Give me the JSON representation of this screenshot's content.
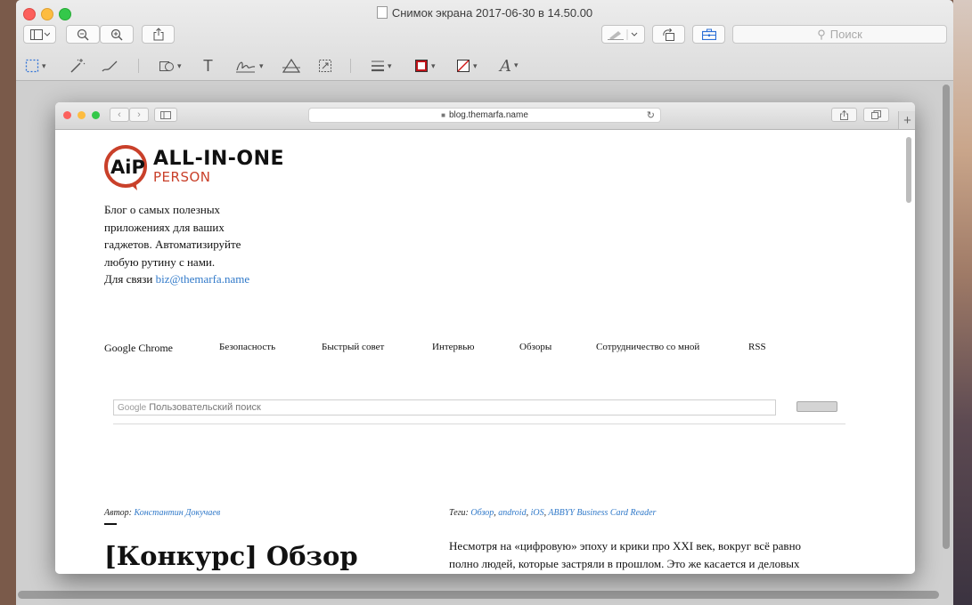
{
  "window": {
    "title": "Снимок экрана 2017-06-30 в 14.50.00",
    "search_placeholder": "Поиск"
  },
  "safari": {
    "url": "blog.themarfa.name"
  },
  "site": {
    "logo_mark": "AiP",
    "logo_line1": "ALL-IN-ONE",
    "logo_line2": "PERSON",
    "about_lines": [
      "Блог о самых полезных",
      "приложениях для ваших",
      "гаджетов. Автоматизируйте",
      "любую рутину с нами."
    ],
    "contact_prefix": "Для связи",
    "contact_email": "biz@themarfa.name",
    "menu": [
      "Google Chrome",
      "Безопасность",
      "Быстрый совет",
      "Интервью",
      "Обзоры",
      "Сотрудничество со мной",
      "RSS"
    ],
    "search_brand": "Google",
    "search_placeholder": "Пользовательский поиск",
    "post": {
      "author_label": "Автор:",
      "author_name": "Константин Докучаев",
      "tags_label": "Теги:",
      "tags": [
        "Обзор",
        "android",
        "iOS",
        "ABBYY Business Card Reader"
      ],
      "title": "[Конкурс] Обзор",
      "body_line1": "Несмотря на «цифровую» эпоху и крики про XXI век, вокруг всё равно",
      "body_line2": "полно людей, которые застряли в прошлом. Это же касается и деловых"
    }
  },
  "colors": {
    "accent_link": "#3079c9",
    "logo_red": "#c9402a"
  }
}
